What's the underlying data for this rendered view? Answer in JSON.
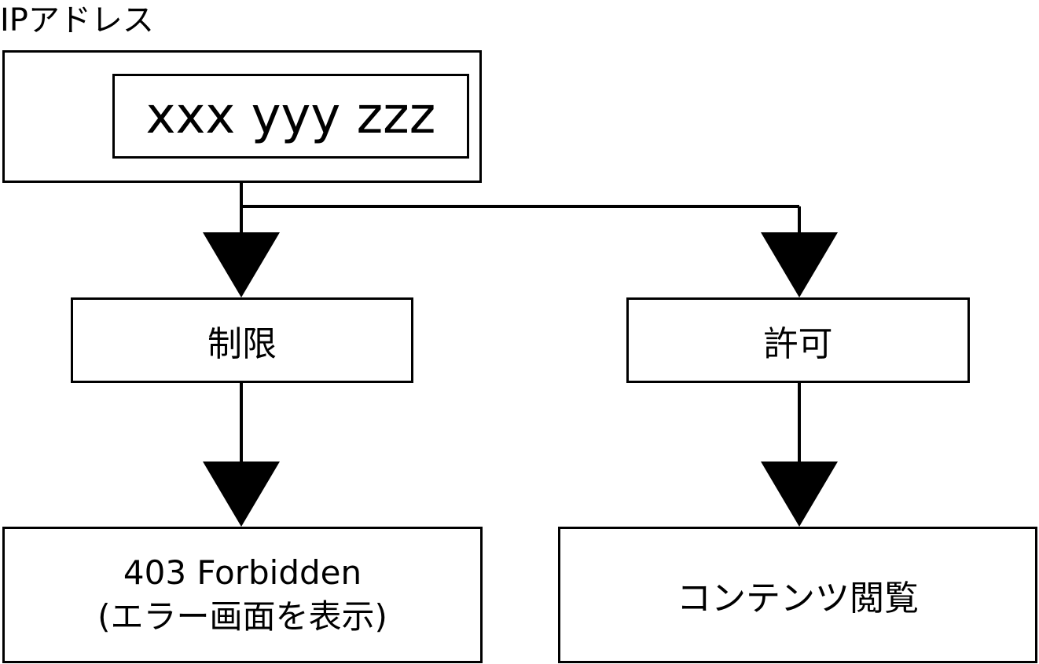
{
  "title": "IPアドレス",
  "ip_value": "xxx yyy zzz",
  "restrict_label": "制限",
  "allow_label": "許可",
  "forbidden": {
    "line1": "403 Forbidden",
    "line2": "(エラー画面を表示)"
  },
  "content_label": "コンテンツ閲覧",
  "colors": {
    "stroke": "#000000",
    "background": "#ffffff"
  }
}
